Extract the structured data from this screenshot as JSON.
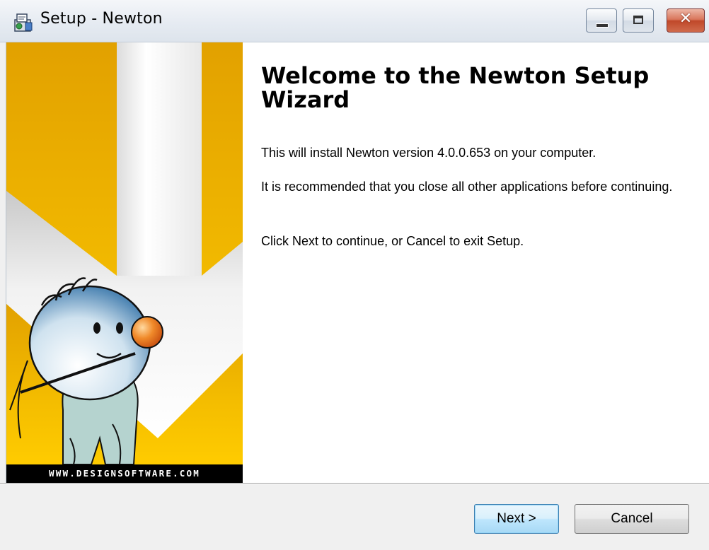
{
  "window": {
    "title": "Setup - Newton",
    "buttons": {
      "minimize": "minimize-icon",
      "maximize": "maximize-icon",
      "close": "✕"
    }
  },
  "banner": {
    "url_text": "WWW.DESIGNSOFTWARE.COM",
    "colors": {
      "yellow": "#fcc700",
      "orange": "#e2a300",
      "white": "#ffffff"
    }
  },
  "main": {
    "title": "Welcome to the Newton Setup Wizard",
    "paragraphs": [
      "This will install Newton version 4.0.0.653 on your computer.",
      "It is recommended that you close all other applications before continuing.",
      "Click Next to continue, or Cancel to exit Setup."
    ]
  },
  "footer": {
    "next_label": "Next >",
    "cancel_label": "Cancel"
  },
  "colors": {
    "next_button_accent": "#3c7fb1",
    "close_button": "#c0482a"
  }
}
